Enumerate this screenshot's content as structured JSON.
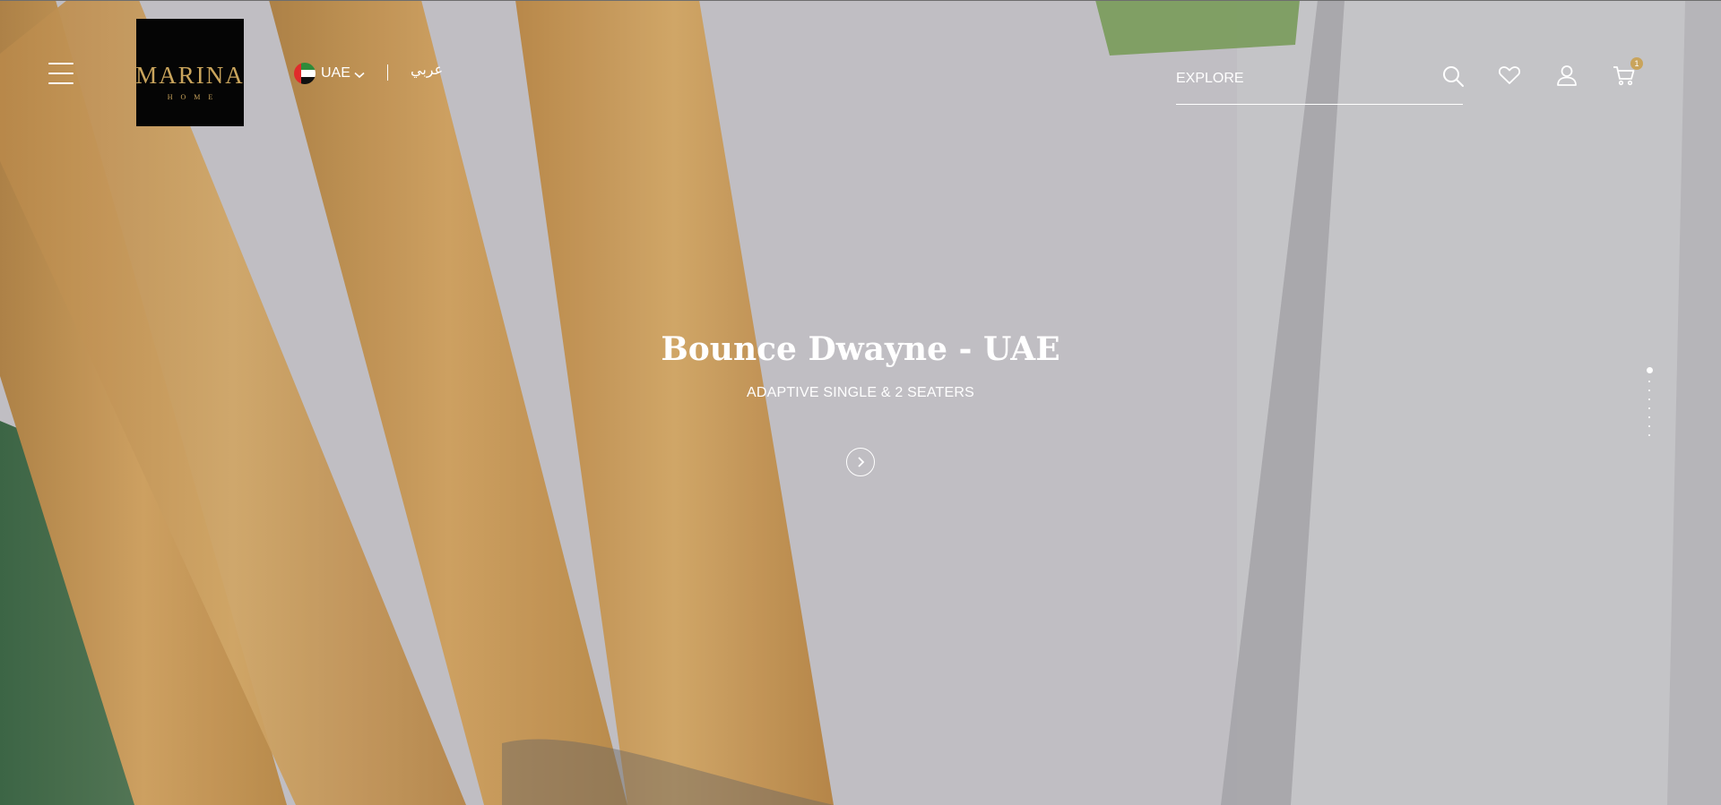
{
  "header": {
    "menu_icon": "hamburger-menu-icon",
    "logo": {
      "word": "MARINA",
      "sub": "HOME"
    },
    "country": {
      "label": "UAE",
      "flag_icon": "uae-flag-icon",
      "chevron_icon": "chevron-down-icon"
    },
    "language_link": "عربي",
    "search": {
      "placeholder": "EXPLORE",
      "icon": "search-icon"
    },
    "wishlist_icon": "heart-icon",
    "account_icon": "user-icon",
    "cart": {
      "icon": "cart-icon",
      "count": "1"
    }
  },
  "hero": {
    "title": "Bounce Dwayne - UAE",
    "subtitle": "ADAPTIVE SINGLE & 2 SEATERS",
    "next_icon": "chevron-right-circle-icon"
  },
  "slider": {
    "slide_count": 8,
    "active_index": 0
  },
  "colors": {
    "accent_gold": "#c9a45c",
    "logo_bg": "#050505",
    "flag_red": "#e02b2b",
    "flag_green": "#2e8b3a",
    "flag_white": "#ffffff",
    "flag_black": "#111111"
  }
}
